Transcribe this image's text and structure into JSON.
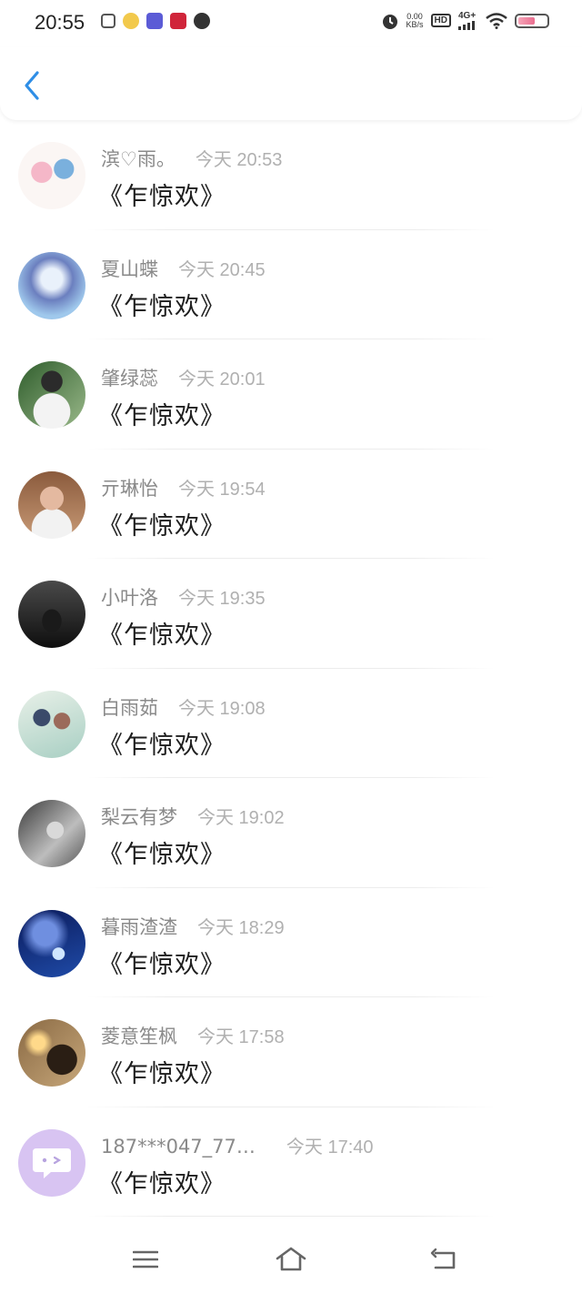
{
  "status_bar": {
    "time": "20:55",
    "net_speed_value": "0.00",
    "net_speed_unit": "KB/s",
    "hd": "HD",
    "network": "4G+",
    "battery_level": 0.6
  },
  "colors": {
    "accent": "#2f8ee6",
    "name": "#8a8a8a",
    "time": "#b0b0b0",
    "message": "#1e1e1e"
  },
  "messages": [
    {
      "name": "滨♡雨。",
      "time": "今天 20:53",
      "text": "《乍惊欢》"
    },
    {
      "name": "夏山蝶",
      "time": "今天 20:45",
      "text": "《乍惊欢》"
    },
    {
      "name": "肇绿蕊",
      "time": "今天 20:01",
      "text": "《乍惊欢》"
    },
    {
      "name": "亓琳怡",
      "time": "今天 19:54",
      "text": "《乍惊欢》"
    },
    {
      "name": "小叶洛",
      "time": "今天 19:35",
      "text": "《乍惊欢》"
    },
    {
      "name": "白雨茹",
      "time": "今天 19:08",
      "text": "《乍惊欢》"
    },
    {
      "name": "梨云有梦",
      "time": "今天 19:02",
      "text": "《乍惊欢》"
    },
    {
      "name": "暮雨渣渣",
      "time": "今天 18:29",
      "text": "《乍惊欢》"
    },
    {
      "name": "菱意笙枫",
      "time": "今天 17:58",
      "text": "《乍惊欢》"
    },
    {
      "name": "187***047_77…",
      "time": "今天 17:40",
      "text": "《乍惊欢》"
    }
  ],
  "icons": {
    "back": "chevron-left-icon",
    "menu": "menu-icon",
    "home": "home-icon",
    "return": "return-icon"
  }
}
